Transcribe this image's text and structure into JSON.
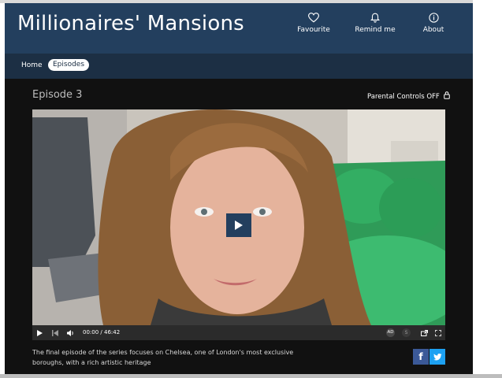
{
  "app": {
    "title": "Millionaires' Mansions"
  },
  "header_actions": [
    {
      "label": "Favourite",
      "icon": "heart-icon"
    },
    {
      "label": "Remind me",
      "icon": "bell-icon"
    },
    {
      "label": "About",
      "icon": "info-icon"
    }
  ],
  "nav": {
    "home": "Home",
    "episodes": "Episodes"
  },
  "episode": {
    "title": "Episode 3",
    "parental_controls": "Parental Controls OFF",
    "description": "The final episode of the series focuses on Chelsea, one of London's most exclusive boroughs, with a rich artistic heritage"
  },
  "player": {
    "current_time": "00:00",
    "separator": "/",
    "duration": "46:42",
    "ad_label": "AD",
    "subtitles_label": "S"
  },
  "share": {
    "facebook": "f",
    "twitter": "twitter-bird"
  },
  "colors": {
    "header_bg": "#233f5e",
    "subnav_bg": "#1c2f44",
    "page_bg": "#111111",
    "facebook": "#3b5998",
    "twitter": "#1da1f2"
  }
}
